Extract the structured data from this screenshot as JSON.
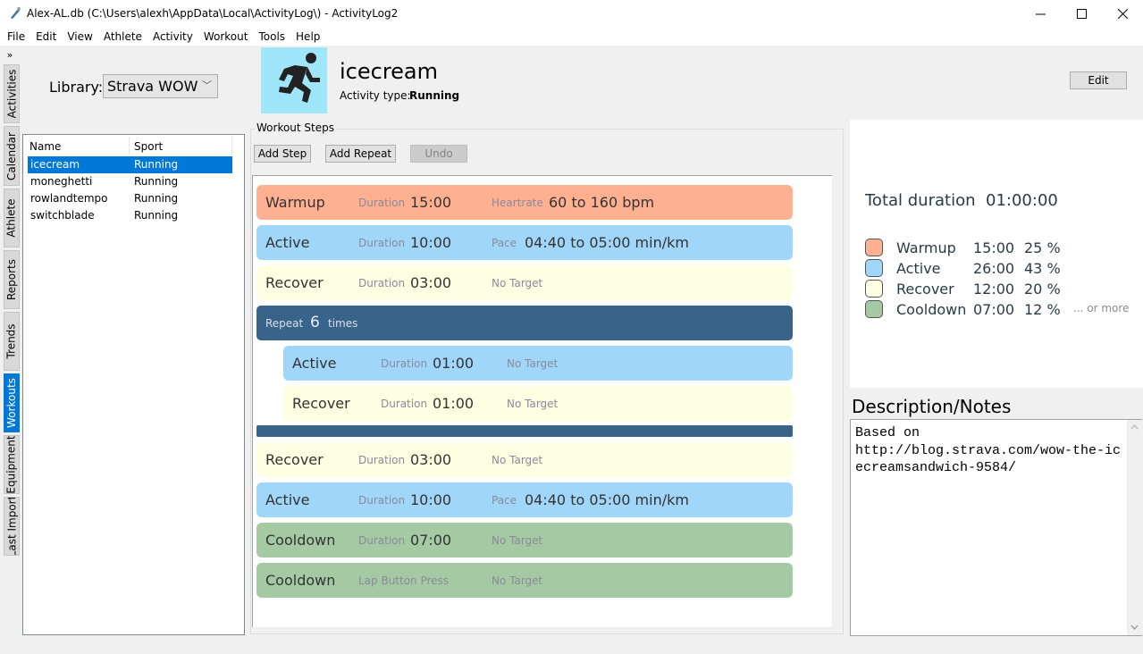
{
  "window": {
    "title": "Alex-AL.db (C:\\Users\\alexh\\AppData\\Local\\ActivityLog\\) - ActivityLog2",
    "minimize": "—",
    "maximize": "☐",
    "close": "✕"
  },
  "menu": [
    "File",
    "Edit",
    "View",
    "Athlete",
    "Activity",
    "Workout",
    "Tools",
    "Help"
  ],
  "side_tabs": {
    "toggle": "»",
    "items": [
      "Activities",
      "Calendar",
      "Athlete",
      "Reports",
      "Trends",
      "Workouts",
      "Equipment",
      "Last Import"
    ],
    "active": "Workouts"
  },
  "library": {
    "label": "Library:",
    "selected": "Strava WOW",
    "columns": [
      "Name",
      "Sport"
    ],
    "rows": [
      {
        "name": "icecream",
        "sport": "Running",
        "selected": true
      },
      {
        "name": "moneghetti",
        "sport": "Running"
      },
      {
        "name": "rowlandtempo",
        "sport": "Running"
      },
      {
        "name": "switchblade",
        "sport": "Running"
      }
    ]
  },
  "workout": {
    "name": "icecream",
    "activity_type_label": "Activity type:",
    "activity_type": "Running",
    "icon": "running-person-icon",
    "edit_label": "Edit"
  },
  "steps_panel": {
    "title": "Workout Steps",
    "add_step": "Add Step",
    "add_repeat": "Add Repeat",
    "undo": "Undo",
    "steps": [
      {
        "type": "Warmup",
        "dur_label": "Duration",
        "dur": "15:00",
        "tgt_label": "Heartrate",
        "tgt": "60 to 160 bpm"
      },
      {
        "type": "Active",
        "dur_label": "Duration",
        "dur": "10:00",
        "tgt_label": "Pace",
        "tgt": "04:40 to 05:00 min/km"
      },
      {
        "type": "Recover",
        "dur_label": "Duration",
        "dur": "03:00",
        "tgt_label": "No Target",
        "tgt": ""
      },
      {
        "repeat_label": "Repeat",
        "repeat_count": "6",
        "repeat_suffix": "times"
      },
      {
        "type": "Active",
        "dur_label": "Duration",
        "dur": "01:00",
        "tgt_label": "No Target",
        "tgt": ""
      },
      {
        "type": "Recover",
        "dur_label": "Duration",
        "dur": "01:00",
        "tgt_label": "No Target",
        "tgt": ""
      },
      {
        "type": "Recover",
        "dur_label": "Duration",
        "dur": "03:00",
        "tgt_label": "No Target",
        "tgt": ""
      },
      {
        "type": "Active",
        "dur_label": "Duration",
        "dur": "10:00",
        "tgt_label": "Pace",
        "tgt": "04:40 to 05:00 min/km"
      },
      {
        "type": "Cooldown",
        "dur_label": "Duration",
        "dur": "07:00",
        "tgt_label": "No Target",
        "tgt": ""
      },
      {
        "type": "Cooldown",
        "dur_label": "Lap Button Press",
        "dur": "",
        "tgt_label": "No Target",
        "tgt": ""
      }
    ]
  },
  "summary": {
    "total_label": "Total duration",
    "total": "01:00:00",
    "legend": [
      {
        "name": "Warmup",
        "time": "15:00",
        "pct": "25 %",
        "color": "#ffb091"
      },
      {
        "name": "Active",
        "time": "26:00",
        "pct": "43 %",
        "color": "#a0d6fa"
      },
      {
        "name": "Recover",
        "time": "12:00",
        "pct": "20 %",
        "color": "#fefee2"
      },
      {
        "name": "Cooldown",
        "time": "07:00",
        "pct": "12 %",
        "color": "#a5c9a3"
      }
    ],
    "or_more": "... or more"
  },
  "description": {
    "title": "Description/Notes",
    "text": "Based on\nhttp://blog.strava.com/wow-the-icecreamsandwich-9584/"
  }
}
